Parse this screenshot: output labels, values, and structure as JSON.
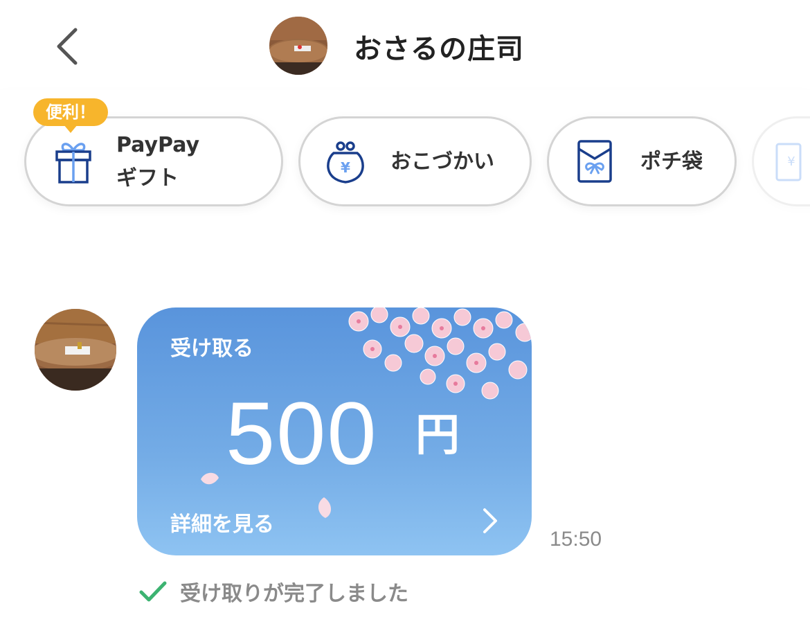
{
  "header": {
    "title": "おさるの庄司",
    "back_icon": "chevron-left-icon"
  },
  "actions": {
    "badge": "便利！",
    "items": [
      {
        "label_line1": "PayPay",
        "label_line2": "ギフト",
        "icon": "gift-icon"
      },
      {
        "label": "おこづかい",
        "icon": "coin-purse-yen-icon"
      },
      {
        "label": "ポチ袋",
        "icon": "envelope-ribbon-icon"
      }
    ]
  },
  "message": {
    "card": {
      "receive_label": "受け取る",
      "amount": "500",
      "currency": "円",
      "detail_label": "詳細を見る"
    },
    "time": "15:50",
    "status": "受け取りが完了しました"
  },
  "colors": {
    "accent_blue": "#1a3e8c",
    "badge_yellow": "#f7b52c",
    "card_top": "#5994dc",
    "card_bottom": "#8ec3f2",
    "check_green": "#3cb371"
  }
}
